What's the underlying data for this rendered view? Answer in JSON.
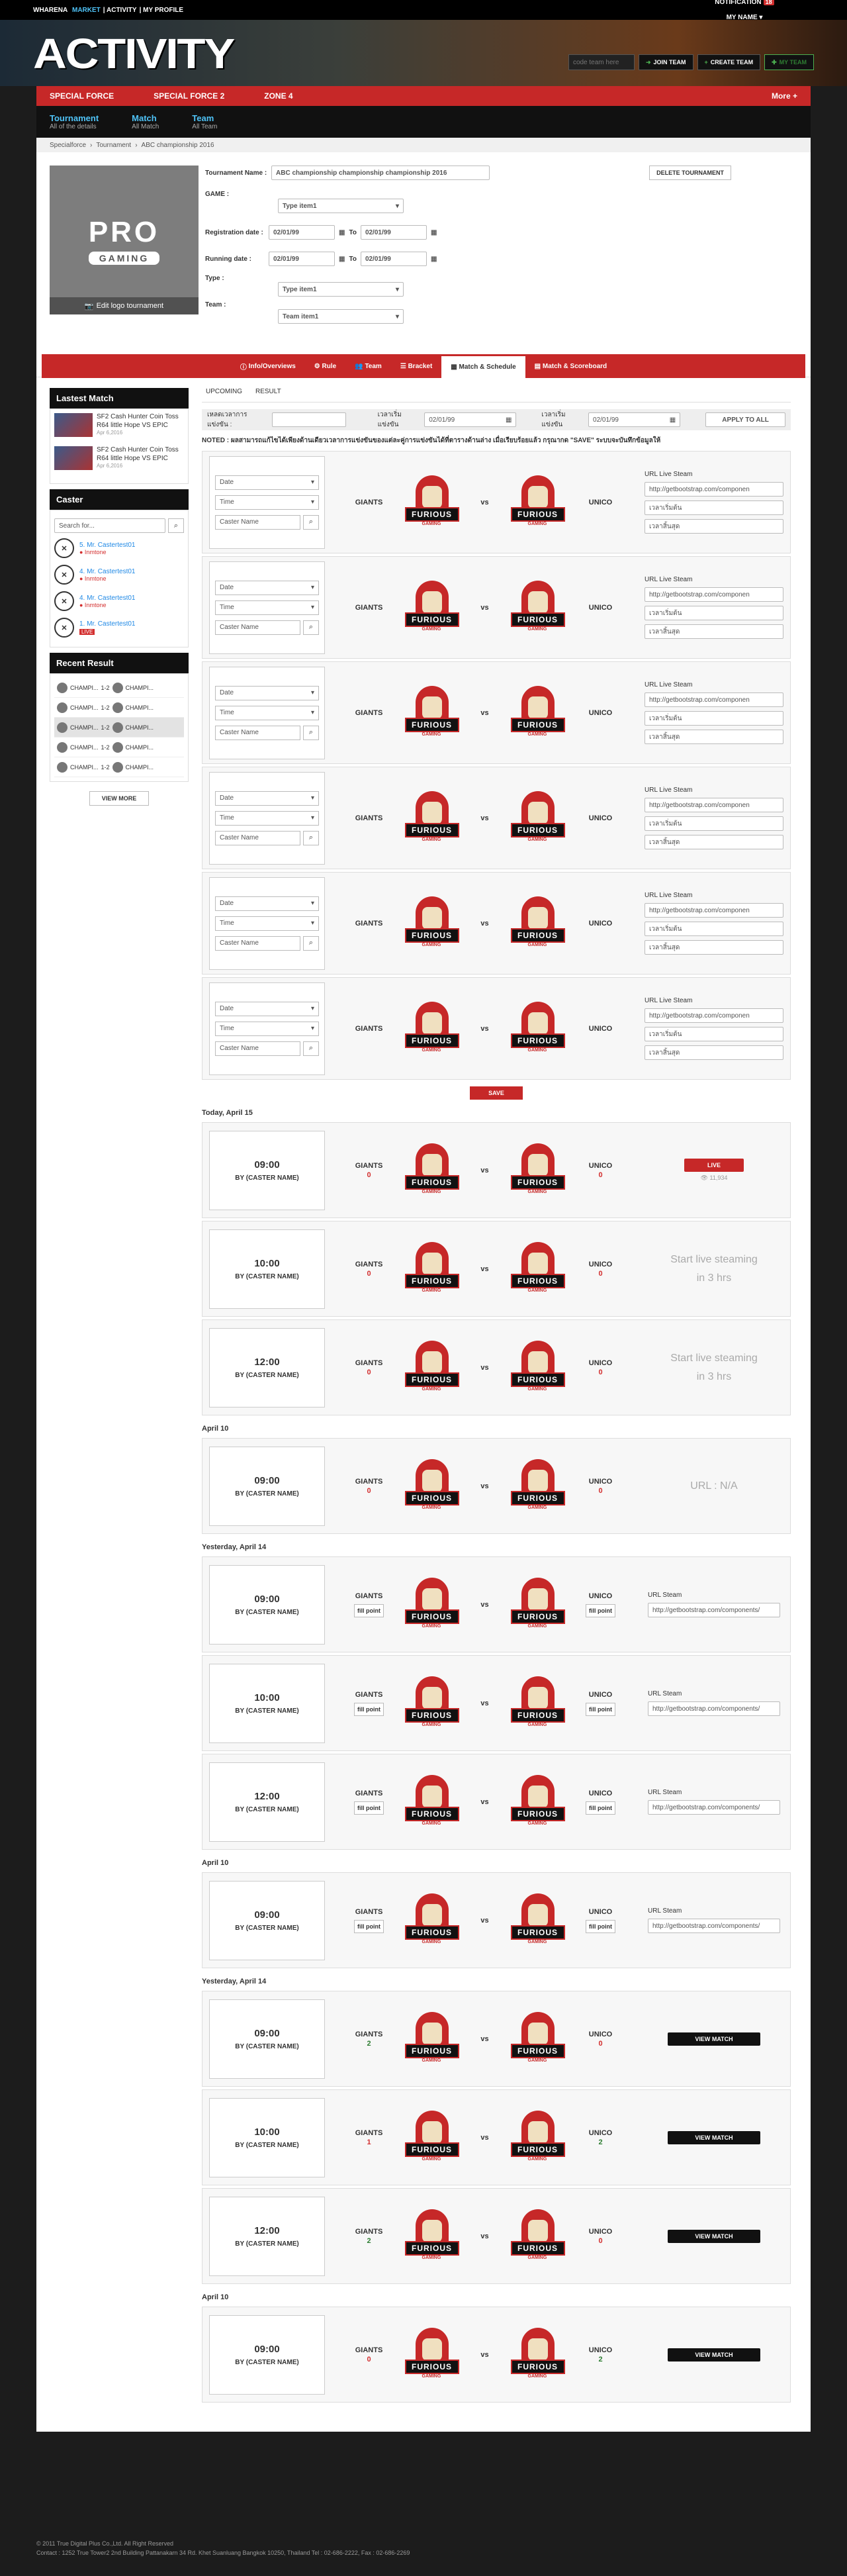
{
  "topbar": {
    "brand": "WHARENA",
    "market": "MARKET",
    "activity": "ACTIVITY",
    "profile": "MY PROFILE",
    "notification": "NOTIFICATION",
    "notif_count": "18",
    "myname": "MY NAME ▾"
  },
  "hero": {
    "title": "ACTIVITY",
    "code_placeholder": "code team here",
    "join": "JOIN TEAM",
    "create": "CREATE TEAM",
    "myteam": "MY TEAM"
  },
  "nav": {
    "items": [
      "SPECIAL FORCE",
      "SPECIAL FORCE 2",
      "ZONE 4"
    ],
    "more": "More +"
  },
  "subnav": [
    {
      "t": "Tournament",
      "s": "All of the details"
    },
    {
      "t": "Match",
      "s": "All Match"
    },
    {
      "t": "Team",
      "s": "All Team"
    }
  ],
  "breadcrumb": [
    "Specialforce",
    "Tournament",
    "ABC championship 2016"
  ],
  "form": {
    "edit_logo": "Edit logo tournament",
    "logo_pro": "PRO",
    "logo_gaming": "GAMING",
    "name_label": "Tournament Name :",
    "name_value": "ABC championship championship championship 2016",
    "game_label": "GAME :",
    "game_value": "Type item1",
    "reg_label": "Registration date :",
    "run_label": "Running date :",
    "date1": "02/01/99",
    "to": "To",
    "date2": "02/01/99",
    "type_label": "Type :",
    "type_value": "Type item1",
    "team_label": "Team :",
    "team_value": "Team item1",
    "delete": "DELETE TOURNAMENT"
  },
  "tabs": [
    "Info/Overviews",
    "Rule",
    "Team",
    "Bracket",
    "Match & Schedule",
    "Match & Scoreboard"
  ],
  "sidebar": {
    "latest": "Lastest Match",
    "matches": [
      {
        "t": "SF2 Cash Hunter Coin Toss R64 little Hope VS EPIC",
        "d": "Apr 6,2016"
      },
      {
        "t": "SF2 Cash Hunter Coin Toss R64 little Hope VS EPIC",
        "d": "Apr 6,2016"
      }
    ],
    "caster": "Caster",
    "search_ph": "Search for...",
    "casters": [
      {
        "n": "5. Mr. Castertest01",
        "s": "● Inmtone"
      },
      {
        "n": "4. Mr. Castertest01",
        "s": "● Inmtone"
      },
      {
        "n": "4. Mr. Castertest01",
        "s": "● Inmtone"
      },
      {
        "n": "1. Mr. Castertest01",
        "s": "LIVE"
      }
    ],
    "recent": "Recent Result",
    "results": [
      {
        "a": "CHAMPI...",
        "sc": "1-2",
        "b": "CHAMPI..."
      },
      {
        "a": "CHAMPI...",
        "sc": "1-2",
        "b": "CHAMPI..."
      },
      {
        "a": "CHAMPI...",
        "sc": "1-2",
        "b": "CHAMPI..."
      },
      {
        "a": "CHAMPI...",
        "sc": "1-2",
        "b": "CHAMPI..."
      },
      {
        "a": "CHAMPI...",
        "sc": "1-2",
        "b": "CHAMPI..."
      }
    ],
    "viewmore": "VIEW MORE"
  },
  "main": {
    "upcoming": "UPCOMING",
    "result": "RESULT",
    "f1": "เหลดเวลาการแข่งขัน :",
    "f2": "เวลาเริ่มแข่งขัน",
    "f3": "เวลาเริ่มแข่งขัน",
    "fdate": "02/01/99",
    "apply": "APPLY TO ALL",
    "note": "NOTED : ผลสามารถแก้ไขได้เพียงด้านเดียวเวลาการแข่งขันของแต่ละคู่การแข่งขันได้ที่ตารางด้านล่าง เมื่อเรียบร้อยแล้ว กรุณากด \"SAVE\" ระบบจะบันทึกข้อมูลให้",
    "date_ph": "Date",
    "time_ph": "Time",
    "caster_ph": "Caster Name",
    "team_a": "GIANTS",
    "team_b": "UNICO",
    "vs": "vs",
    "url_label": "URL Live Steam",
    "url_value": "http://getbootstrap.com/componen",
    "start_ph": "เวลาเริ่มต้น",
    "end_ph": "เวลาสิ้นสุด",
    "save": "SAVE",
    "emb": "FURIOUS",
    "emb2": "GAMING",
    "d1": "Today, April 15",
    "d2": "April 10",
    "d3": "Yesterday, April 14",
    "d4": "April 10",
    "d5": "Yesterday, April 14",
    "d6": "April 10",
    "by": "BY (CASTER NAME)",
    "live": "LIVE",
    "views": "👁 11,934",
    "soon1": "Start live steaming",
    "soon2": "in 3 hrs",
    "na": "URL : N/A",
    "fill": "fill point",
    "url_stream": "URL Steam",
    "url2": "http://getbootstrap.com/components/",
    "viewmatch": "VIEW MATCH",
    "times": [
      "09:00",
      "10:00",
      "12:00"
    ]
  },
  "footer": {
    "l1": "© 2011 True Digital Plus Co.,Ltd. All Right Reserved",
    "l2": "Contact : 1252 True Tower2 2nd Building Pattanakarn 34 Rd. Khet Suanluang Bangkok 10250, Thailand Tel : 02-686-2222, Fax : 02-686-2269"
  },
  "colors": {
    "accent": "#c62828",
    "link": "#4fc3f7"
  }
}
